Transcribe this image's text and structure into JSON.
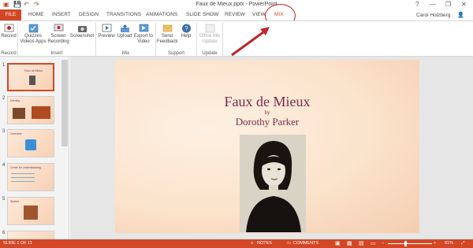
{
  "window": {
    "title": "Faux de Mieux.pptx - PowerPoint",
    "help": "?",
    "minimize": "—",
    "restore": "❐",
    "close": "✕"
  },
  "qat": {
    "save": "💾",
    "undo": "↶",
    "redo": "↷"
  },
  "tabs": [
    {
      "label": "FILE"
    },
    {
      "label": "HOME"
    },
    {
      "label": "INSERT"
    },
    {
      "label": "DESIGN"
    },
    {
      "label": "TRANSITIONS"
    },
    {
      "label": "ANIMATIONS"
    },
    {
      "label": "SLIDE SHOW"
    },
    {
      "label": "REVIEW"
    },
    {
      "label": "VIEW"
    },
    {
      "label": "MIX"
    }
  ],
  "user": "Carol Holzberg",
  "ribbon": {
    "record": "Record",
    "quizzes": "Quizzes Videos Apps",
    "screen_recording": "Screen Recording",
    "screenshot": "Screenshot",
    "preview": "Preview",
    "upload": "Upload",
    "export": "Export to Video",
    "send_feedback": "Send Feedback",
    "help": "Help",
    "update": "Office Mix Update",
    "groups": {
      "record": "Record",
      "insert": "Insert",
      "mix": "Mix",
      "support": "Support",
      "update": "Update"
    }
  },
  "thumbnails": [
    {
      "num": "1",
      "title": "Faux de Mieux"
    },
    {
      "num": "2",
      "title": "Dorothy"
    },
    {
      "num": "3",
      "title": "Overview"
    },
    {
      "num": "4",
      "title": "Check for Understanding"
    },
    {
      "num": "5",
      "title": "Stories"
    },
    {
      "num": "6",
      "title": ""
    }
  ],
  "slide": {
    "title": "Faux de Mieux",
    "by": "by",
    "author": "Dorothy Parker"
  },
  "status": {
    "slide": "SLIDE 1 OF 11",
    "notes": "NOTES",
    "comments": "COMMENTS",
    "zoom": "61%"
  },
  "colors": {
    "accent": "#d24726",
    "slide_title": "#7a2a4b",
    "annotation": "#c0232b"
  }
}
